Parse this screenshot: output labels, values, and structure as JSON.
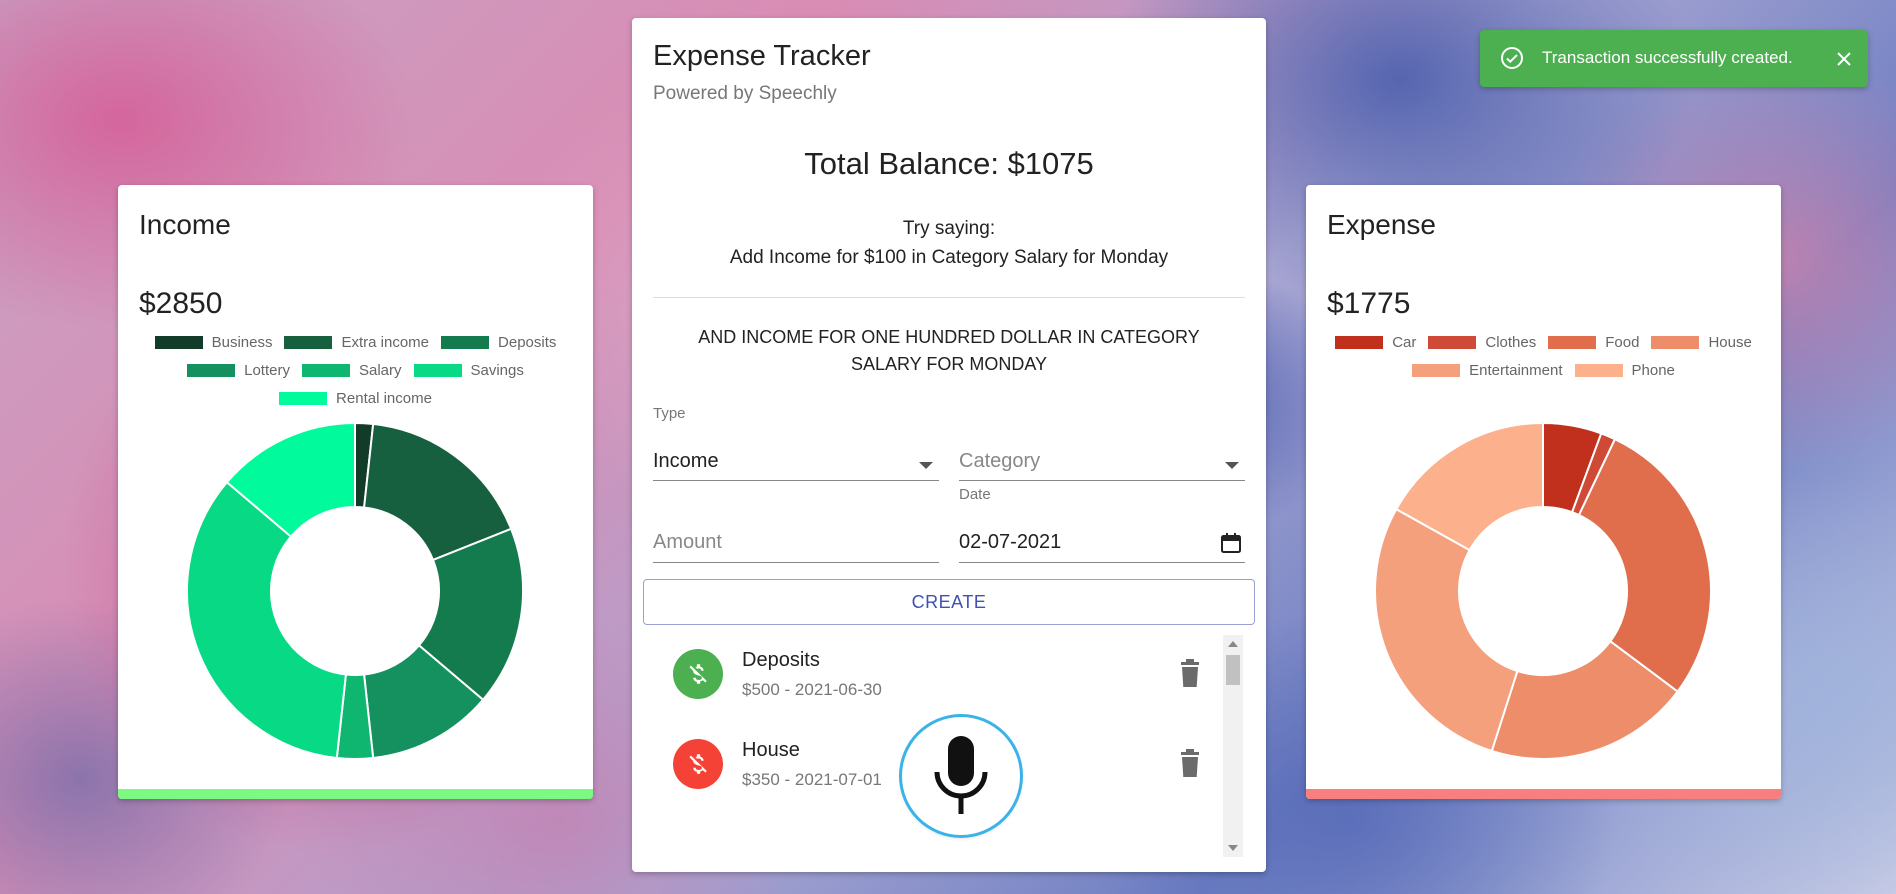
{
  "toast": {
    "message": "Transaction successfully created.",
    "bg_color": "#4caf50"
  },
  "income": {
    "title": "Income",
    "total": "$2850",
    "bar_color": "#7cf983",
    "chart_data": {
      "type": "pie",
      "categories": [
        "Business",
        "Extra income",
        "Deposits",
        "Lottery",
        "Salary",
        "Savings",
        "Rental income"
      ],
      "values": [
        50,
        500,
        500,
        350,
        100,
        1000,
        400
      ],
      "colors": [
        "#123b2a",
        "#16603f",
        "#147b4e",
        "#159160",
        "#0fb66f",
        "#08d985",
        "#01fb9c"
      ],
      "cutout": 0.5
    }
  },
  "expense": {
    "title": "Expense",
    "total": "$1775",
    "bar_color": "#f77f7f",
    "chart_data": {
      "type": "pie",
      "categories": [
        "Car",
        "Clothes",
        "Food",
        "House",
        "Entertainment",
        "Phone"
      ],
      "values": [
        100,
        25,
        500,
        350,
        500,
        300
      ],
      "colors": [
        "#c1301d",
        "#cf4a36",
        "#e06e4d",
        "#ee8d69",
        "#f4a07c",
        "#fcb08c"
      ],
      "cutout": 0.5
    }
  },
  "main": {
    "title": "Expense Tracker",
    "subtitle": "Powered by Speechly",
    "balance": "Total Balance: $1075",
    "try_label": "Try saying:",
    "try_text": "Add Income for $100 in Category Salary for Monday",
    "transcript": "AND INCOME FOR ONE HUNDRED DOLLAR IN CATEGORY SALARY FOR MONDAY",
    "form": {
      "type_label": "Type",
      "type_value": "Income",
      "category_placeholder": "Category",
      "amount_placeholder": "Amount",
      "date_label": "Date",
      "date_value": "02-07-2021",
      "create_label": "CREATE"
    },
    "transactions": [
      {
        "category": "Deposits",
        "detail": "$500 - 2021-06-30",
        "kind": "income",
        "color": "#4caf50"
      },
      {
        "category": "House",
        "detail": "$350 - 2021-07-01",
        "kind": "expense",
        "color": "#f44336"
      }
    ]
  }
}
